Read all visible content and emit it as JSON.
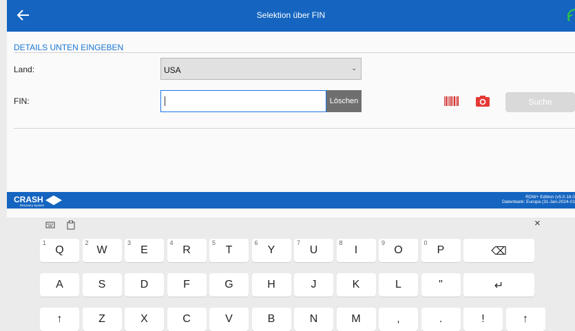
{
  "topbar": {
    "title": "Selektion über FIN",
    "back_icon": "arrow-left-icon",
    "status_icon": "wifi-icon"
  },
  "form": {
    "section_title": "DETAILS UNTEN EINGEBEN",
    "land_label": "Land:",
    "land_value": "USA",
    "fin_label": "FIN:",
    "fin_value": "",
    "clear_label": "Löschen",
    "search_label": "Suche"
  },
  "footer": {
    "logo_text": "CRASH",
    "logo_sub": "Recovery System",
    "version_line1": "RDW+ Edition (v5.0.18.0",
    "version_line2": "Datenbank: Europa (31-Jan-2024-01"
  },
  "keyboard": {
    "close_label": "×",
    "row1": [
      {
        "k": "Q",
        "n": "1"
      },
      {
        "k": "W",
        "n": "2"
      },
      {
        "k": "E",
        "n": "3"
      },
      {
        "k": "R",
        "n": "4"
      },
      {
        "k": "T",
        "n": "5"
      },
      {
        "k": "Y",
        "n": "6"
      },
      {
        "k": "U",
        "n": "7"
      },
      {
        "k": "I",
        "n": "8"
      },
      {
        "k": "O",
        "n": "9"
      },
      {
        "k": "P",
        "n": "0"
      }
    ],
    "row2": [
      "A",
      "S",
      "D",
      "F",
      "G",
      "H",
      "J",
      "K",
      "L",
      "\""
    ],
    "row3": [
      "↑",
      "Z",
      "X",
      "C",
      "V",
      "B",
      "N",
      "M",
      ",",
      ".",
      "!",
      "↑"
    ],
    "backspace": "⌫",
    "enter": "↵"
  },
  "colors": {
    "header": "#1565c0",
    "accent": "#1976d2",
    "clear_button": "#6f6f6f",
    "camera": "#e53935",
    "barcode": "#d32f2f"
  }
}
